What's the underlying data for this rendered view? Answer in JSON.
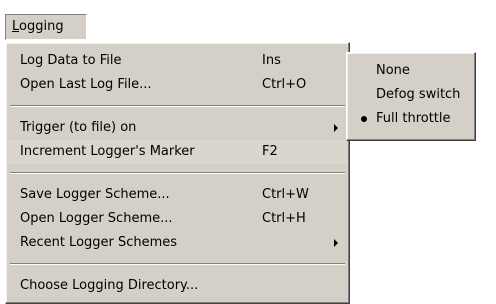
{
  "menubar": {
    "title_mnemonic": "L",
    "title_rest": "ogging"
  },
  "menu": {
    "log_data_to_file": {
      "label": "Log Data to File",
      "shortcut": "Ins"
    },
    "open_last_log_file": {
      "label": "Open Last Log File...",
      "shortcut": "Ctrl+O"
    },
    "trigger_on": {
      "label": "Trigger (to file) on"
    },
    "increment_marker": {
      "label": "Increment Logger's Marker",
      "shortcut": "F2"
    },
    "save_scheme": {
      "label": "Save Logger Scheme...",
      "shortcut": "Ctrl+W"
    },
    "open_scheme": {
      "label": "Open Logger Scheme...",
      "shortcut": "Ctrl+H"
    },
    "recent_schemes": {
      "label": "Recent Logger Schemes"
    },
    "choose_directory": {
      "label": "Choose Logging Directory..."
    }
  },
  "submenu": {
    "items": [
      {
        "label": "None",
        "selected": false
      },
      {
        "label": "Defog switch",
        "selected": false
      },
      {
        "label": "Full throttle",
        "selected": true
      }
    ]
  },
  "colors": {
    "menu_face": "#d4d0c8",
    "shadow": "#808080",
    "dark_shadow": "#404040",
    "highlight": "#ffffff"
  },
  "icons": {
    "submenu_arrow": "right-triangle",
    "radio_bullet": "filled-circle"
  }
}
